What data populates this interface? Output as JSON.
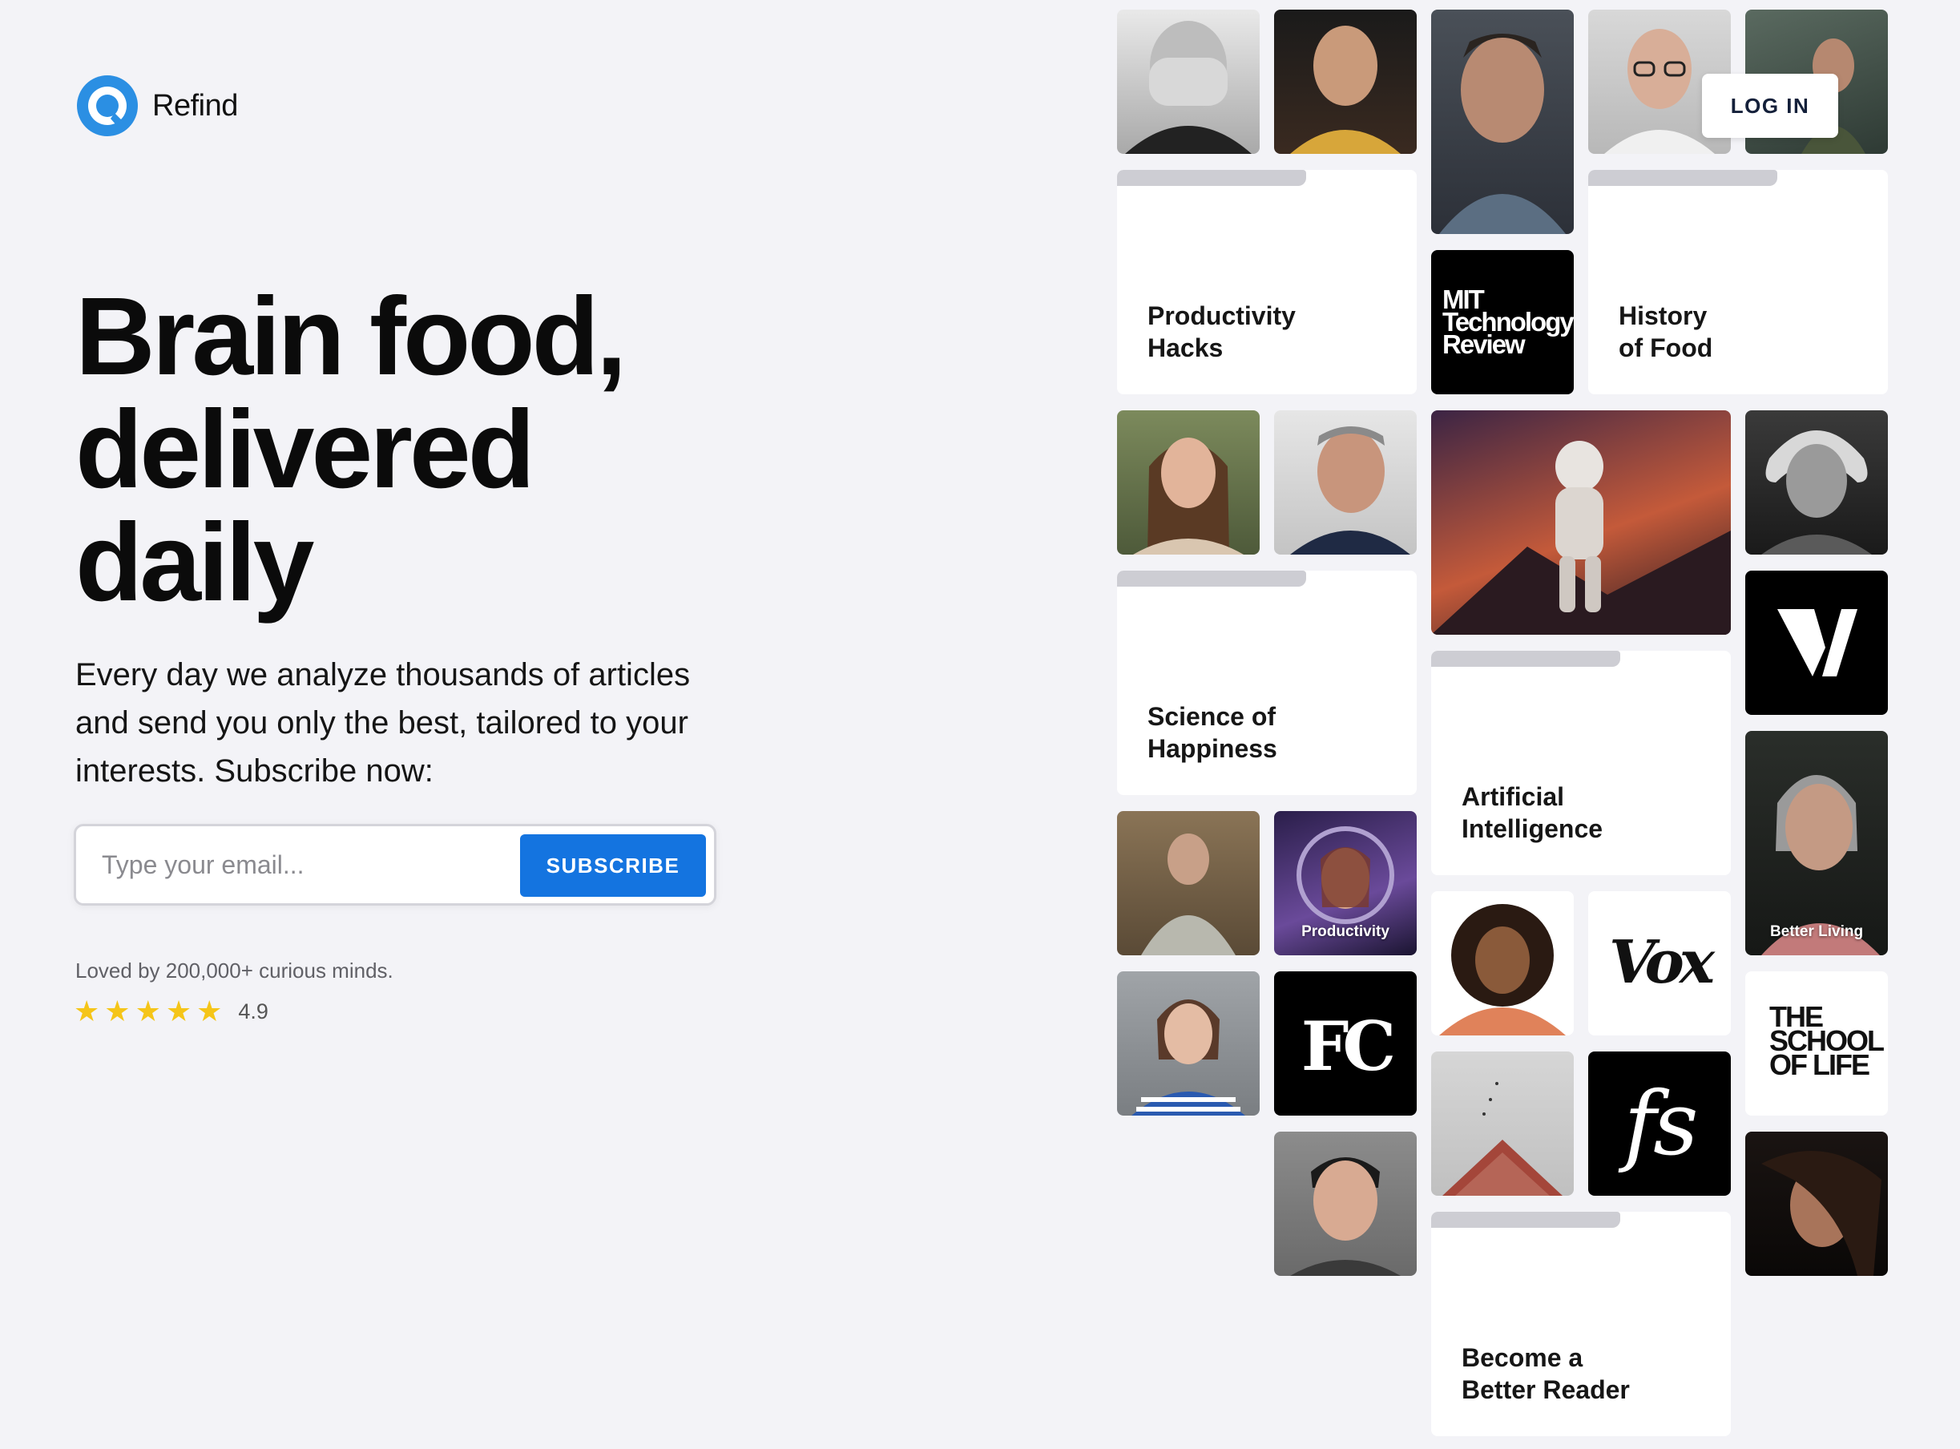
{
  "brand": {
    "name": "Refind",
    "accent": "#2b8fe3"
  },
  "hero": {
    "headline": "Brain food, delivered daily",
    "subtext": "Every day we analyze thousands of articles and send you only the best, tailored to your interests. Subscribe now:"
  },
  "subscribe": {
    "placeholder": "Type your email...",
    "button_label": "SUBSCRIBE",
    "button_color": "#1474e0"
  },
  "social_proof": {
    "loved_text": "Loved by 200,000+ curious minds.",
    "stars": 5,
    "rating": "4.9",
    "star_color": "#f5c518"
  },
  "nav": {
    "login_label": "LOG IN"
  },
  "topics": {
    "productivity_hacks": "Productivity\nHacks",
    "history_of_food": "History\nof Food",
    "science_of_happiness": "Science of\nHappiness",
    "artificial_intelligence": "Artificial\nIntelligence",
    "better_reader": "Become a\nBetter Reader"
  },
  "tile_labels": {
    "productivity": "Productivity",
    "better_living": "Better Living"
  },
  "publications": {
    "mit": [
      "MIT",
      "Technology",
      "Review"
    ],
    "vox": "Vox",
    "fc": "FC",
    "fs": "fs",
    "school_of_life": [
      "THE",
      "SCHOOL",
      "OF LIFE"
    ]
  }
}
